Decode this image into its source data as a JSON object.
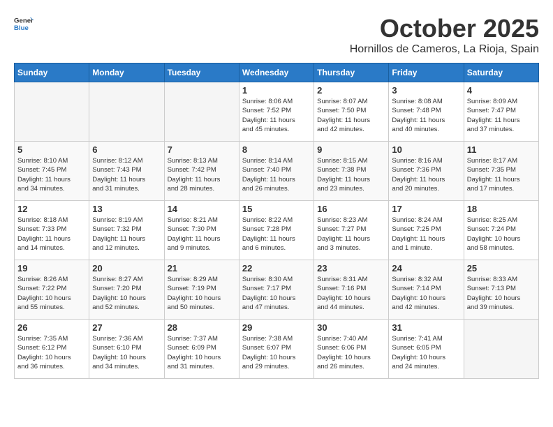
{
  "header": {
    "logo_general": "General",
    "logo_blue": "Blue",
    "title": "October 2025",
    "subtitle": "Hornillos de Cameros, La Rioja, Spain"
  },
  "weekdays": [
    "Sunday",
    "Monday",
    "Tuesday",
    "Wednesday",
    "Thursday",
    "Friday",
    "Saturday"
  ],
  "weeks": [
    [
      {
        "day": "",
        "info": ""
      },
      {
        "day": "",
        "info": ""
      },
      {
        "day": "",
        "info": ""
      },
      {
        "day": "1",
        "info": "Sunrise: 8:06 AM\nSunset: 7:52 PM\nDaylight: 11 hours\nand 45 minutes."
      },
      {
        "day": "2",
        "info": "Sunrise: 8:07 AM\nSunset: 7:50 PM\nDaylight: 11 hours\nand 42 minutes."
      },
      {
        "day": "3",
        "info": "Sunrise: 8:08 AM\nSunset: 7:48 PM\nDaylight: 11 hours\nand 40 minutes."
      },
      {
        "day": "4",
        "info": "Sunrise: 8:09 AM\nSunset: 7:47 PM\nDaylight: 11 hours\nand 37 minutes."
      }
    ],
    [
      {
        "day": "5",
        "info": "Sunrise: 8:10 AM\nSunset: 7:45 PM\nDaylight: 11 hours\nand 34 minutes."
      },
      {
        "day": "6",
        "info": "Sunrise: 8:12 AM\nSunset: 7:43 PM\nDaylight: 11 hours\nand 31 minutes."
      },
      {
        "day": "7",
        "info": "Sunrise: 8:13 AM\nSunset: 7:42 PM\nDaylight: 11 hours\nand 28 minutes."
      },
      {
        "day": "8",
        "info": "Sunrise: 8:14 AM\nSunset: 7:40 PM\nDaylight: 11 hours\nand 26 minutes."
      },
      {
        "day": "9",
        "info": "Sunrise: 8:15 AM\nSunset: 7:38 PM\nDaylight: 11 hours\nand 23 minutes."
      },
      {
        "day": "10",
        "info": "Sunrise: 8:16 AM\nSunset: 7:36 PM\nDaylight: 11 hours\nand 20 minutes."
      },
      {
        "day": "11",
        "info": "Sunrise: 8:17 AM\nSunset: 7:35 PM\nDaylight: 11 hours\nand 17 minutes."
      }
    ],
    [
      {
        "day": "12",
        "info": "Sunrise: 8:18 AM\nSunset: 7:33 PM\nDaylight: 11 hours\nand 14 minutes."
      },
      {
        "day": "13",
        "info": "Sunrise: 8:19 AM\nSunset: 7:32 PM\nDaylight: 11 hours\nand 12 minutes."
      },
      {
        "day": "14",
        "info": "Sunrise: 8:21 AM\nSunset: 7:30 PM\nDaylight: 11 hours\nand 9 minutes."
      },
      {
        "day": "15",
        "info": "Sunrise: 8:22 AM\nSunset: 7:28 PM\nDaylight: 11 hours\nand 6 minutes."
      },
      {
        "day": "16",
        "info": "Sunrise: 8:23 AM\nSunset: 7:27 PM\nDaylight: 11 hours\nand 3 minutes."
      },
      {
        "day": "17",
        "info": "Sunrise: 8:24 AM\nSunset: 7:25 PM\nDaylight: 11 hours\nand 1 minute."
      },
      {
        "day": "18",
        "info": "Sunrise: 8:25 AM\nSunset: 7:24 PM\nDaylight: 10 hours\nand 58 minutes."
      }
    ],
    [
      {
        "day": "19",
        "info": "Sunrise: 8:26 AM\nSunset: 7:22 PM\nDaylight: 10 hours\nand 55 minutes."
      },
      {
        "day": "20",
        "info": "Sunrise: 8:27 AM\nSunset: 7:20 PM\nDaylight: 10 hours\nand 52 minutes."
      },
      {
        "day": "21",
        "info": "Sunrise: 8:29 AM\nSunset: 7:19 PM\nDaylight: 10 hours\nand 50 minutes."
      },
      {
        "day": "22",
        "info": "Sunrise: 8:30 AM\nSunset: 7:17 PM\nDaylight: 10 hours\nand 47 minutes."
      },
      {
        "day": "23",
        "info": "Sunrise: 8:31 AM\nSunset: 7:16 PM\nDaylight: 10 hours\nand 44 minutes."
      },
      {
        "day": "24",
        "info": "Sunrise: 8:32 AM\nSunset: 7:14 PM\nDaylight: 10 hours\nand 42 minutes."
      },
      {
        "day": "25",
        "info": "Sunrise: 8:33 AM\nSunset: 7:13 PM\nDaylight: 10 hours\nand 39 minutes."
      }
    ],
    [
      {
        "day": "26",
        "info": "Sunrise: 7:35 AM\nSunset: 6:12 PM\nDaylight: 10 hours\nand 36 minutes."
      },
      {
        "day": "27",
        "info": "Sunrise: 7:36 AM\nSunset: 6:10 PM\nDaylight: 10 hours\nand 34 minutes."
      },
      {
        "day": "28",
        "info": "Sunrise: 7:37 AM\nSunset: 6:09 PM\nDaylight: 10 hours\nand 31 minutes."
      },
      {
        "day": "29",
        "info": "Sunrise: 7:38 AM\nSunset: 6:07 PM\nDaylight: 10 hours\nand 29 minutes."
      },
      {
        "day": "30",
        "info": "Sunrise: 7:40 AM\nSunset: 6:06 PM\nDaylight: 10 hours\nand 26 minutes."
      },
      {
        "day": "31",
        "info": "Sunrise: 7:41 AM\nSunset: 6:05 PM\nDaylight: 10 hours\nand 24 minutes."
      },
      {
        "day": "",
        "info": ""
      }
    ]
  ]
}
